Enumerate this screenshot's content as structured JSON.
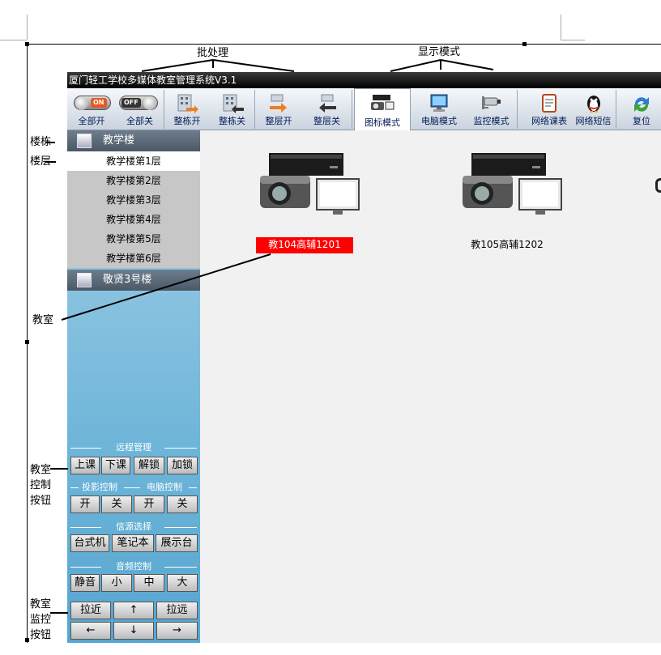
{
  "annotations": {
    "batch": "批处理",
    "display_mode": "显示模式",
    "building": "楼栋",
    "floor": "楼层",
    "classroom": "教室",
    "classroom_control_buttons": [
      "教室",
      "控制",
      "按钮"
    ],
    "classroom_monitor_buttons": [
      "教室",
      "监控",
      "按钮"
    ]
  },
  "app": {
    "title": "厦门轻工学校多媒体教室管理系统V3.1"
  },
  "toolbar": {
    "all_on": "全部开",
    "all_off": "全部关",
    "on_badge": "ON",
    "off_badge": "OFF",
    "building_on": "整栋开",
    "building_off": "整栋关",
    "floor_on": "整层开",
    "floor_off": "整层关",
    "icon_mode": "图标模式",
    "pc_mode": "电脑模式",
    "monitor_mode": "监控模式",
    "schedule": "网络课表",
    "sms": "网络短信",
    "reset": "复位"
  },
  "sidebar": {
    "buildings": [
      {
        "name": "教学楼"
      },
      {
        "name": "敬贤3号楼"
      }
    ],
    "floors": [
      "教学楼第1层",
      "教学楼第2层",
      "教学楼第3层",
      "教学楼第4层",
      "教学楼第5层",
      "教学楼第6层"
    ],
    "remote": {
      "title": "远程管理",
      "buttons": [
        "上课",
        "下课",
        "解锁",
        "加锁"
      ]
    },
    "projector": {
      "title": "投影控制",
      "on": "开",
      "off": "关"
    },
    "computer": {
      "title": "电脑控制",
      "on": "开",
      "off": "关"
    },
    "source": {
      "title": "信源选择",
      "buttons": [
        "台式机",
        "笔记本",
        "展示台"
      ]
    },
    "audio": {
      "title": "音频控制",
      "buttons": [
        "静音",
        "小",
        "中",
        "大"
      ]
    },
    "camera": {
      "zoom_in": "拉近",
      "up": "↑",
      "zoom_out": "拉远",
      "left": "←",
      "down": "↓",
      "right": "→"
    }
  },
  "rooms": [
    {
      "label": "教104高辅1201",
      "selected": true
    },
    {
      "label": "教105高辅1202",
      "selected": false
    }
  ],
  "colors": {
    "selected_room": "#ff0000",
    "titlebar": "#000000",
    "sidebar_gradient_top": "#a7cfe7",
    "sidebar_gradient_bottom": "#56a6d0"
  }
}
